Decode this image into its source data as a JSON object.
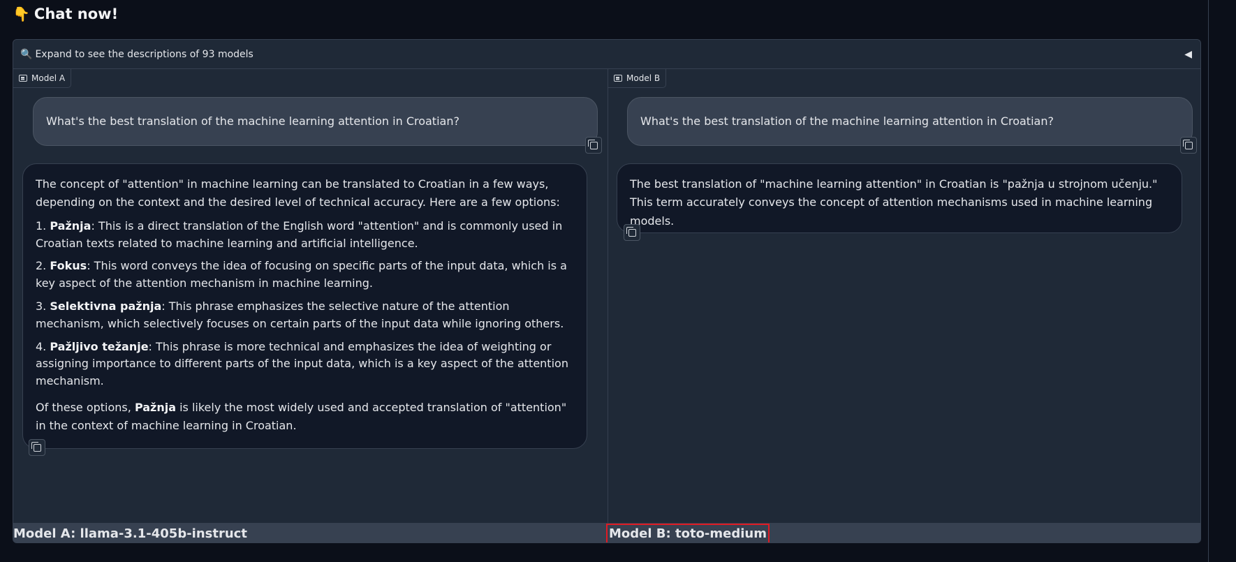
{
  "header": {
    "emoji": "👇",
    "title": "Chat now!"
  },
  "accordion": {
    "icon": "🔍",
    "label": "Expand to see the descriptions of 93 models",
    "toggle": "◀"
  },
  "model_a": {
    "label": "Model A",
    "user_message": "What's the best translation of the machine learning attention in Croatian?",
    "response": {
      "intro": "The concept of \"attention\" in machine learning can be translated to Croatian in a few ways, depending on the context and the desired level of technical accuracy. Here are a few options:",
      "options": [
        {
          "num": "1. ",
          "term": "Pažnja",
          "text": ": This is a direct translation of the English word \"attention\" and is commonly used in Croatian texts related to machine learning and artificial intelligence."
        },
        {
          "num": "2. ",
          "term": "Fokus",
          "text": ": This word conveys the idea of focusing on specific parts of the input data, which is a key aspect of the attention mechanism in machine learning."
        },
        {
          "num": "3. ",
          "term": "Selektivna pažnja",
          "text": ": This phrase emphasizes the selective nature of the attention mechanism, which selectively focuses on certain parts of the input data while ignoring others."
        },
        {
          "num": "4. ",
          "term": "Pažljivo težanje",
          "text": ": This phrase is more technical and emphasizes the idea of weighting or assigning importance to different parts of the input data, which is a key aspect of the attention mechanism."
        }
      ],
      "conclusion_pre": "Of these options, ",
      "conclusion_term": "Pažnja",
      "conclusion_post": " is likely the most widely used and accepted translation of \"attention\" in the context of machine learning in Croatian."
    },
    "footer": "Model A: llama-3.1-405b-instruct"
  },
  "model_b": {
    "label": "Model B",
    "user_message": "What's the best translation of the machine learning attention in Croatian?",
    "response": "The best translation of \"machine learning attention\" in Croatian is \"pažnja u strojnom učenju.\" This term accurately conveys the concept of attention mechanisms used in machine learning models.",
    "footer": "Model B: toto-medium"
  },
  "colors": {
    "background": "#0b0f19",
    "panel": "#1f2937",
    "bubble_user": "#374151",
    "bubble_bot": "#111827",
    "highlight": "#e01b24"
  }
}
